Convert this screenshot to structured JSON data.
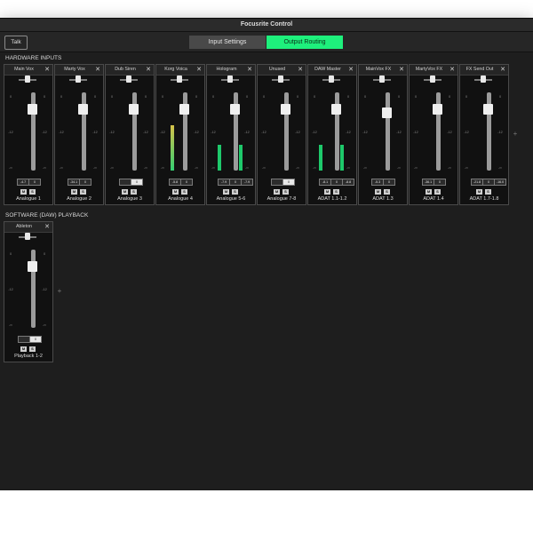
{
  "window": {
    "title": "Focusrite Control"
  },
  "toolbar": {
    "talk_label": "Talk",
    "tabs": [
      {
        "label": "Input Settings",
        "active": false
      },
      {
        "label": "Output Routing",
        "active": true
      }
    ]
  },
  "sections": {
    "hardware": {
      "title": "HARDWARE INPUTS",
      "strips": [
        {
          "name": "Main Vox",
          "output": "Analogue 1",
          "values": [
            "-4.7",
            "0"
          ],
          "pan": 0,
          "fader": 0.78,
          "meters": []
        },
        {
          "name": "Marty Vox",
          "output": "Analogue 2",
          "values": [
            "-34.1",
            "0"
          ],
          "pan": 0,
          "fader": 0.78,
          "meters": []
        },
        {
          "name": "Dub Siren",
          "output": "Analogue 3",
          "values": [
            "",
            "0"
          ],
          "pan": 0,
          "fader": 0.78,
          "meters": []
        },
        {
          "name": "Korg Voica",
          "output": "Analogue 4",
          "values": [
            "-5.8",
            "0"
          ],
          "pan": 0,
          "fader": 0.78,
          "meters": [
            {
              "level": 0.58,
              "color": "yellow"
            }
          ]
        },
        {
          "name": "Hologram",
          "output": "Analogue 5-6",
          "values": [
            "-7.9",
            "0",
            "-7.9"
          ],
          "pan": 0,
          "fader": 0.78,
          "meters": [
            {
              "level": 0.33,
              "color": "green"
            },
            {
              "level": 0.33,
              "color": "green"
            }
          ]
        },
        {
          "name": "Unused",
          "output": "Analogue 7-8",
          "values": [
            "",
            "0"
          ],
          "pan": 0,
          "fader": 0.78,
          "meters": []
        },
        {
          "name": "DAW Master",
          "output": "ADAT 1.1-1.2",
          "values": [
            "-8.1",
            "0",
            "-8.8"
          ],
          "pan": 0,
          "fader": 0.78,
          "meters": [
            {
              "level": 0.33,
              "color": "green"
            },
            {
              "level": 0.33,
              "color": "green"
            }
          ]
        },
        {
          "name": "MainVox FX",
          "output": "ADAT 1.3",
          "values": [
            "-5.3",
            "0"
          ],
          "pan": 0,
          "fader": 0.74,
          "meters": []
        },
        {
          "name": "MartyVox FX",
          "output": "ADAT 1.4",
          "values": [
            "-36.1",
            "0"
          ],
          "pan": 0,
          "fader": 0.78,
          "meters": []
        },
        {
          "name": "FX Send Out",
          "output": "ADAT 1.7-1.8",
          "values": [
            "-21.8",
            "0",
            "-16.0"
          ],
          "pan": 0,
          "fader": 0.78,
          "meters": []
        }
      ]
    },
    "daw": {
      "title": "SOFTWARE (DAW) PLAYBACK",
      "strips": [
        {
          "name": "Ableton",
          "output": "Playback 1-2",
          "values": [
            "",
            "0"
          ],
          "pan": 0,
          "fader": 0.78,
          "meters": []
        }
      ]
    }
  },
  "labels": {
    "mute": "M",
    "solo": "S",
    "add": "+",
    "close": "✕",
    "scale": [
      "0",
      "-12",
      "-∞"
    ]
  },
  "colors": {
    "accent": "#1ef07c",
    "meter_green": "#1ec96b",
    "meter_yellow": "#d6c24a"
  }
}
